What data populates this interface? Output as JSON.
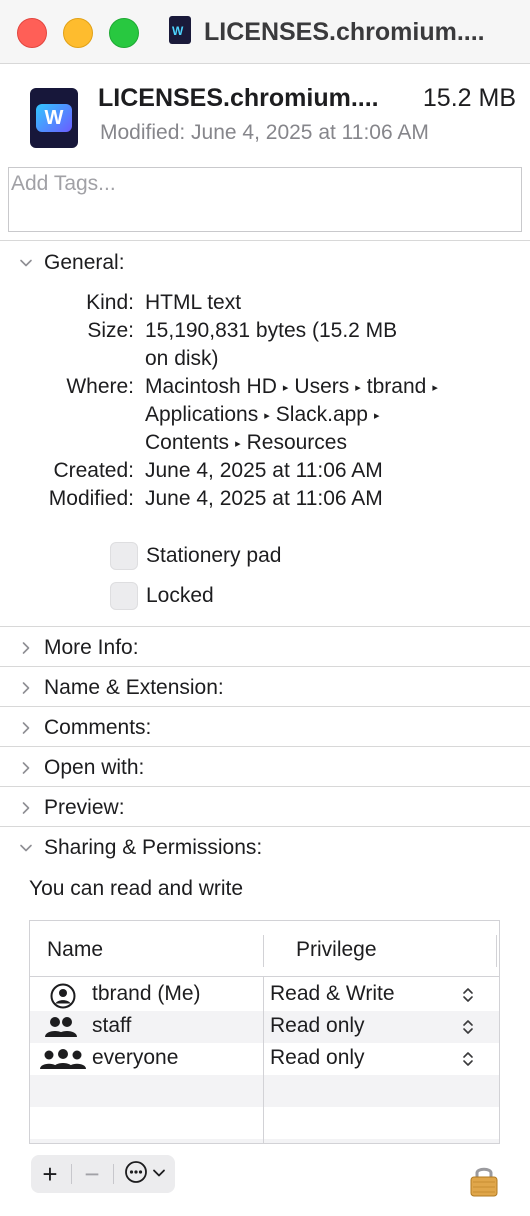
{
  "window": {
    "title": "LICENSES.chromium...."
  },
  "header": {
    "file_name": "LICENSES.chromium....",
    "file_size": "15.2 MB",
    "modified": "Modified: June 4, 2025 at 11:06 AM"
  },
  "tags": {
    "placeholder": "Add Tags..."
  },
  "general": {
    "heading": "General:",
    "kind_label": "Kind:",
    "kind_value": "HTML text",
    "size_label": "Size:",
    "size_value_line1": "15,190,831 bytes (15.2 MB",
    "size_value_line2": "on disk)",
    "where_label": "Where:",
    "where_path": [
      "Macintosh HD",
      "Users",
      "tbrand",
      "Applications",
      "Slack.app",
      "Contents",
      "Resources"
    ],
    "created_label": "Created:",
    "created_value": "June 4, 2025 at 11:06 AM",
    "modified_label": "Modified:",
    "modified_value": "June 4, 2025 at 11:06 AM",
    "stationery_label": "Stationery pad",
    "locked_label": "Locked"
  },
  "sections": {
    "more_info": "More Info:",
    "name_extension": "Name & Extension:",
    "comments": "Comments:",
    "open_with": "Open with:",
    "preview": "Preview:",
    "sharing": "Sharing & Permissions:"
  },
  "sharing": {
    "status": "You can read and write",
    "col_name": "Name",
    "col_privilege": "Privilege",
    "rows": [
      {
        "name": "tbrand (Me)",
        "privilege": "Read & Write",
        "icon": "user-circle-icon"
      },
      {
        "name": "staff",
        "privilege": "Read only",
        "icon": "group-icon"
      },
      {
        "name": "everyone",
        "privilege": "Read only",
        "icon": "everyone-icon"
      }
    ]
  },
  "toolbar": {
    "add": "+",
    "remove": "−"
  },
  "colors": {
    "red": "#ff5f57",
    "yellow": "#febc2e",
    "green": "#28c840",
    "lock": "#e0a64a"
  }
}
